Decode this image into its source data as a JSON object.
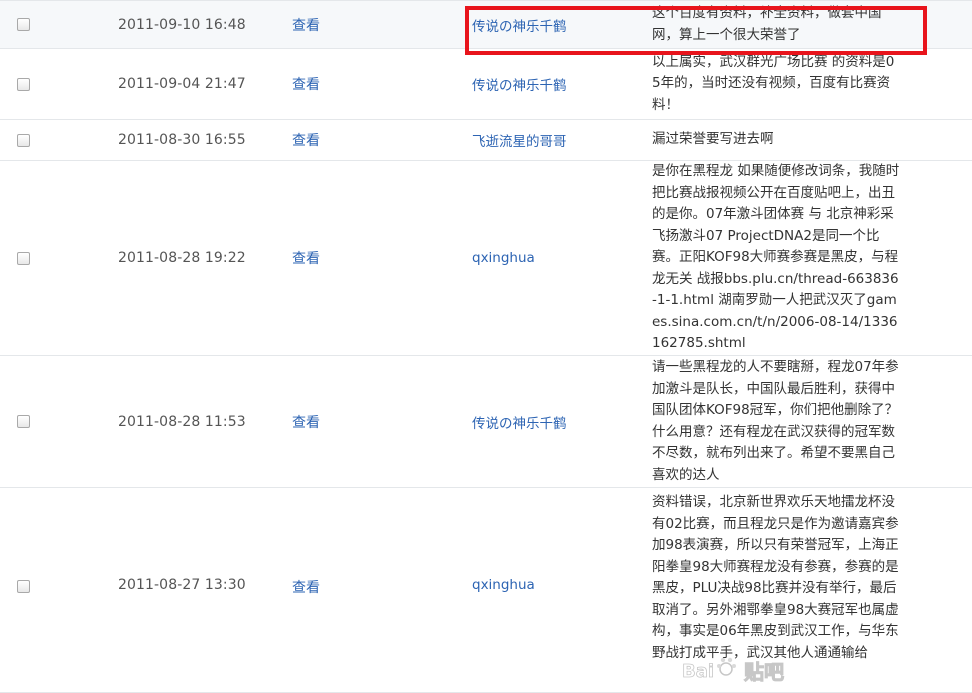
{
  "rows": [
    {
      "time": "2011-09-10 16:48",
      "view": "查看",
      "user": "传说の神乐千鹤",
      "content": "这个百度有资料，补全资料，做套中国网，算上一个很大荣誉了"
    },
    {
      "time": "2011-09-04 21:47",
      "view": "查看",
      "user": "传说の神乐千鹤",
      "content": "以上属实，武汉群光广场比赛 的资料是05年的，当时还没有视频，百度有比赛资料！"
    },
    {
      "time": "2011-08-30 16:55",
      "view": "查看",
      "user": "飞逝流星的哥哥",
      "content": "漏过荣誉要写进去啊"
    },
    {
      "time": "2011-08-28 19:22",
      "view": "查看",
      "user": "qxinghua",
      "content": "是你在黑程龙 如果随便修改词条，我随时把比赛战报视频公开在百度贴吧上，出丑的是你。07年激斗团体赛 与 北京神彩采飞扬激斗07 ProjectDNA2是同一个比赛。正阳KOF98大师赛参赛是黑皮，与程龙无关 战报bbs.plu.cn/thread-663836-1-1.html 湖南罗勋一人把武汉灭了games.sina.com.cn/t/n/2006-08-14/1336162785.shtml"
    },
    {
      "time": "2011-08-28 11:53",
      "view": "查看",
      "user": "传说の神乐千鹤",
      "content": "请一些黑程龙的人不要瞎掰，程龙07年参加激斗是队长，中国队最后胜利，获得中国队团体KOF98冠军，你们把他删除了？什么用意？还有程龙在武汉获得的冠军数不尽数，就布列出来了。希望不要黑自己喜欢的达人"
    },
    {
      "time": "2011-08-27 13:30",
      "view": "查看",
      "user": "qxinghua",
      "content": "资料错误，北京新世界欢乐天地擂龙杯没有02比赛，而且程龙只是作为邀请嘉宾参加98表演赛，所以只有荣誉冠军，上海正阳拳皇98大师赛程龙没有参赛，参赛的是黑皮，PLU决战98比赛并没有举行，最后取消了。另外湘鄂拳皇98大赛冠军也属虚构，事实是06年黑皮到武汉工作，与华东野战打成平手，武汉其他人通通输给"
    }
  ],
  "watermark": {
    "text": "贴吧",
    "logo": "baidu-tieba-logo"
  },
  "colors": {
    "link": "#2d64b3",
    "highlight": "#e8141c",
    "border": "#e4e7ea"
  }
}
